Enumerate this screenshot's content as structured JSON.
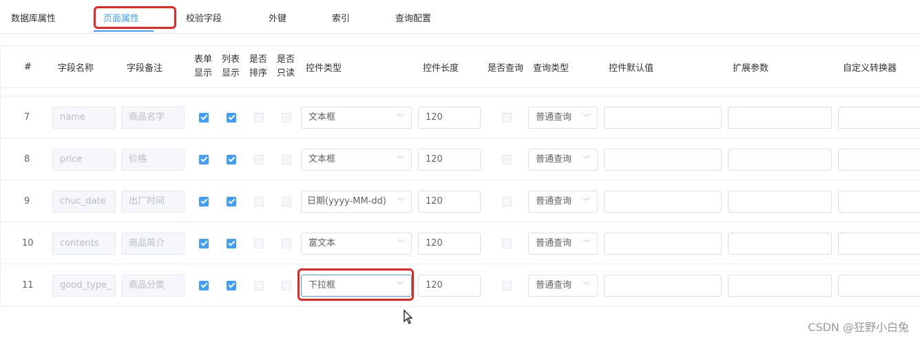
{
  "tabs": [
    {
      "label": "数据库属性",
      "active": false
    },
    {
      "label": "页面属性",
      "active": true
    },
    {
      "label": "校验字段",
      "active": false
    },
    {
      "label": "外键",
      "active": false
    },
    {
      "label": "索引",
      "active": false
    },
    {
      "label": "查询配置",
      "active": false
    }
  ],
  "headers": {
    "index": "#",
    "field_name": "字段名称",
    "field_comment": "字段备注",
    "form_show_1": "表单",
    "form_show_2": "显示",
    "list_show_1": "列表",
    "list_show_2": "显示",
    "sortable_1": "是否",
    "sortable_2": "排序",
    "readonly_1": "是否",
    "readonly_2": "只读",
    "control_type": "控件类型",
    "control_length": "控件长度",
    "is_query": "是否查询",
    "query_type": "查询类型",
    "default_value": "控件默认值",
    "ext_params": "扩展参数",
    "converter": "自定义转换器"
  },
  "rows": [
    {
      "index": "7",
      "field_name": "name",
      "field_comment": "商品名字",
      "form_show": true,
      "list_show": true,
      "sortable": false,
      "readonly": false,
      "control_type": "文本框",
      "control_length": "120",
      "is_query": false,
      "query_type": "普通查询",
      "default_value": "",
      "ext_params": "",
      "converter": ""
    },
    {
      "index": "8",
      "field_name": "price",
      "field_comment": "价格",
      "form_show": true,
      "list_show": true,
      "sortable": false,
      "readonly": false,
      "control_type": "文本框",
      "control_length": "120",
      "is_query": false,
      "query_type": "普通查询",
      "default_value": "",
      "ext_params": "",
      "converter": ""
    },
    {
      "index": "9",
      "field_name": "chuc_date",
      "field_comment": "出厂时间",
      "form_show": true,
      "list_show": true,
      "sortable": false,
      "readonly": false,
      "control_type": "日期(yyyy-MM-dd)",
      "control_length": "120",
      "is_query": false,
      "query_type": "普通查询",
      "default_value": "",
      "ext_params": "",
      "converter": ""
    },
    {
      "index": "10",
      "field_name": "contents",
      "field_comment": "商品简介",
      "form_show": true,
      "list_show": true,
      "sortable": false,
      "readonly": false,
      "control_type": "富文本",
      "control_length": "120",
      "is_query": false,
      "query_type": "普通查询",
      "default_value": "",
      "ext_params": "",
      "converter": ""
    },
    {
      "index": "11",
      "field_name": "good_type_",
      "field_comment": "商品分类",
      "form_show": true,
      "list_show": true,
      "sortable": false,
      "readonly": false,
      "control_type": "下拉框",
      "control_length": "120",
      "is_query": false,
      "query_type": "普通查询",
      "default_value": "",
      "ext_params": "",
      "converter": ""
    }
  ],
  "icons": {
    "select_chevron": "chevron-down-icon",
    "cursor": "mouse-pointer-icon"
  },
  "colors": {
    "accent": "#409eff",
    "highlight": "#e8261f"
  },
  "watermark": "CSDN @狂野小白兔"
}
